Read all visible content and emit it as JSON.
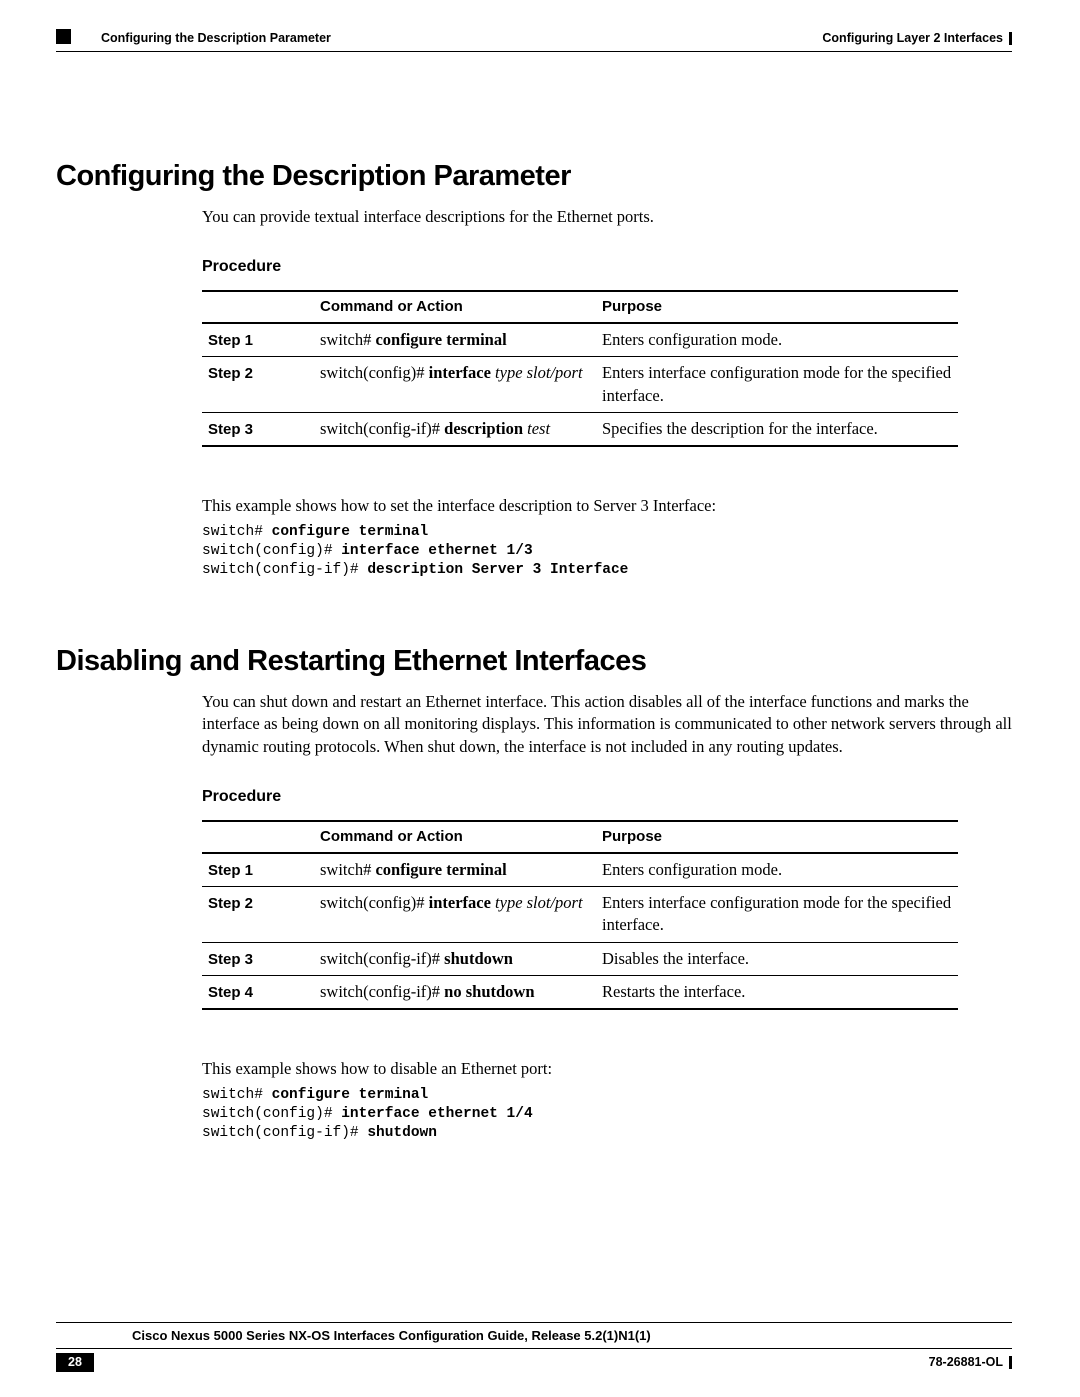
{
  "header": {
    "left": "Configuring the Description Parameter",
    "right": "Configuring Layer 2 Interfaces"
  },
  "section1": {
    "title": "Configuring the Description Parameter",
    "intro": "You can provide textual interface descriptions for the Ethernet ports.",
    "procedure_heading": "Procedure",
    "table": {
      "col1": "",
      "col2": "Command or Action",
      "col3": "Purpose",
      "rows": [
        {
          "step": "Step 1",
          "prompt": "switch# ",
          "cmd_bold": "configure terminal",
          "cmd_ital": "",
          "purpose": "Enters configuration mode."
        },
        {
          "step": "Step 2",
          "prompt": "switch(config)# ",
          "cmd_bold": "interface ",
          "cmd_ital": "type slot/port",
          "purpose": "Enters interface configuration mode for the specified interface."
        },
        {
          "step": "Step 3",
          "prompt": "switch(config-if)# ",
          "cmd_bold": "description ",
          "cmd_ital": "test",
          "purpose": "Specifies the description for the interface."
        }
      ]
    },
    "example_intro": "This example shows how to set the interface description to Server 3 Interface:",
    "cli": [
      {
        "p": "switch# ",
        "b": "configure terminal"
      },
      {
        "p": "switch(config)# ",
        "b": "interface ethernet 1/3"
      },
      {
        "p": "switch(config-if)# ",
        "b": "description Server 3 Interface"
      }
    ]
  },
  "section2": {
    "title": "Disabling and Restarting Ethernet Interfaces",
    "intro": "You can shut down and restart an Ethernet interface. This action disables all of the interface functions and marks the interface as being down on all monitoring displays. This information is communicated to other network servers through all dynamic routing protocols. When shut down, the interface is not included in any routing updates.",
    "procedure_heading": "Procedure",
    "table": {
      "col1": "",
      "col2": "Command or Action",
      "col3": "Purpose",
      "rows": [
        {
          "step": "Step 1",
          "prompt": "switch# ",
          "cmd_bold": "configure terminal",
          "cmd_ital": "",
          "purpose": "Enters configuration mode."
        },
        {
          "step": "Step 2",
          "prompt": "switch(config)# ",
          "cmd_bold": "interface ",
          "cmd_ital": "type slot/port",
          "purpose": "Enters interface configuration mode for the specified interface."
        },
        {
          "step": "Step 3",
          "prompt": "switch(config-if)# ",
          "cmd_bold": "shutdown",
          "cmd_ital": "",
          "purpose": "Disables the interface."
        },
        {
          "step": "Step 4",
          "prompt": "switch(config-if)# ",
          "cmd_bold": "no shutdown",
          "cmd_ital": "",
          "purpose": "Restarts the interface."
        }
      ]
    },
    "example_intro": "This example shows how to disable an Ethernet port:",
    "cli": [
      {
        "p": "switch# ",
        "b": "configure terminal"
      },
      {
        "p": "switch(config)# ",
        "b": "interface ethernet 1/4"
      },
      {
        "p": "switch(config-if)# ",
        "b": "shutdown"
      }
    ]
  },
  "footer": {
    "guide": "Cisco Nexus 5000 Series NX-OS Interfaces Configuration Guide, Release 5.2(1)N1(1)",
    "page": "28",
    "docnum": "78-26881-OL"
  }
}
